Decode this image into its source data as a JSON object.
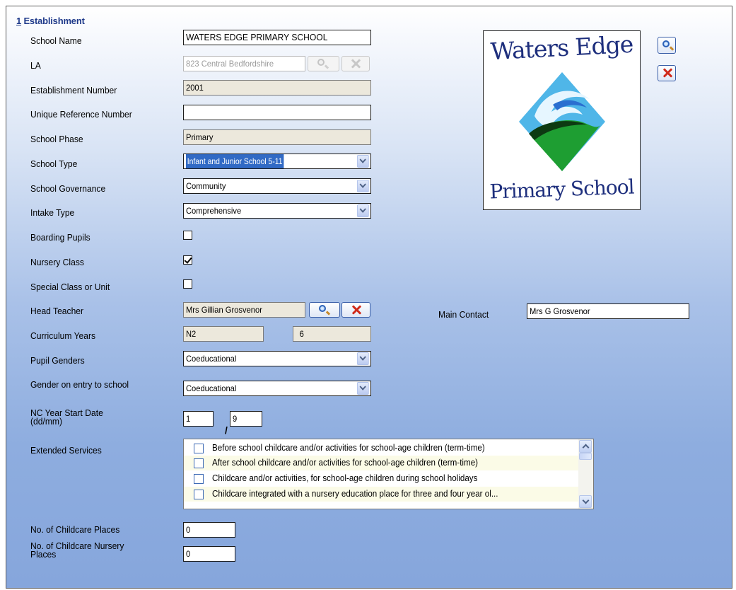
{
  "section": {
    "number": "1",
    "title": "Establishment"
  },
  "labels": {
    "school_name": "School Name",
    "la": "LA",
    "establishment_number": "Establishment Number",
    "urn": "Unique Reference Number",
    "school_phase": "School Phase",
    "school_type": "School Type",
    "school_governance": "School Governance",
    "intake_type": "Intake Type",
    "boarding_pupils": "Boarding Pupils",
    "nursery_class": "Nursery Class",
    "special_class": "Special Class or Unit",
    "head_teacher": "Head Teacher",
    "main_contact": "Main Contact",
    "curriculum_years": "Curriculum Years",
    "pupil_genders": "Pupil Genders",
    "gender_on_entry": "Gender on entry to school",
    "nc_year_start": "NC Year Start Date (dd/mm)",
    "extended_services": "Extended Services",
    "childcare_places": "No. of Childcare Places",
    "childcare_nursery_places": "No. of Childcare Nursery Places"
  },
  "values": {
    "school_name": "WATERS EDGE PRIMARY SCHOOL",
    "la": "823 Central Bedfordshire",
    "establishment_number": "2001",
    "urn": "",
    "school_phase": "Primary",
    "school_type": "Infant and Junior School 5-11",
    "school_governance": "Community",
    "intake_type": "Comprehensive",
    "boarding_pupils": false,
    "nursery_class": true,
    "special_class": false,
    "head_teacher": "Mrs Gillian Grosvenor",
    "main_contact": "Mrs G Grosvenor",
    "curriculum_from": "N2",
    "curriculum_to": "6",
    "pupil_genders": "Coeducational",
    "gender_on_entry": "Coeducational",
    "nc_day": "1",
    "nc_month": "9",
    "nc_separator": "/",
    "childcare_places": "0",
    "childcare_nursery_places": "0"
  },
  "extended_services": [
    {
      "label": "Before school childcare and/or activities for school-age children (term-time)",
      "checked": false
    },
    {
      "label": "After school childcare and/or activities for school-age children (term-time)",
      "checked": false
    },
    {
      "label": "Childcare and/or activities, for school-age children during school holidays",
      "checked": false
    },
    {
      "label": "Childcare integrated with a nursery education place for three and four year ol...",
      "checked": false
    }
  ],
  "logo": {
    "top_text": "Waters Edge",
    "bottom_text": "Primary School"
  },
  "icons": {
    "search": "magnifier-icon",
    "remove": "red-x-icon",
    "dropdown": "chevron-down-icon",
    "scroll_up": "chevron-up-icon",
    "scroll_down": "chevron-down-icon"
  },
  "colors": {
    "section_title": "#1f3a8a",
    "readonly_field": "#ece8dc",
    "selection": "#316ac5",
    "remove_icon": "#d02a1a",
    "logo_text": "#1e2f7d"
  }
}
